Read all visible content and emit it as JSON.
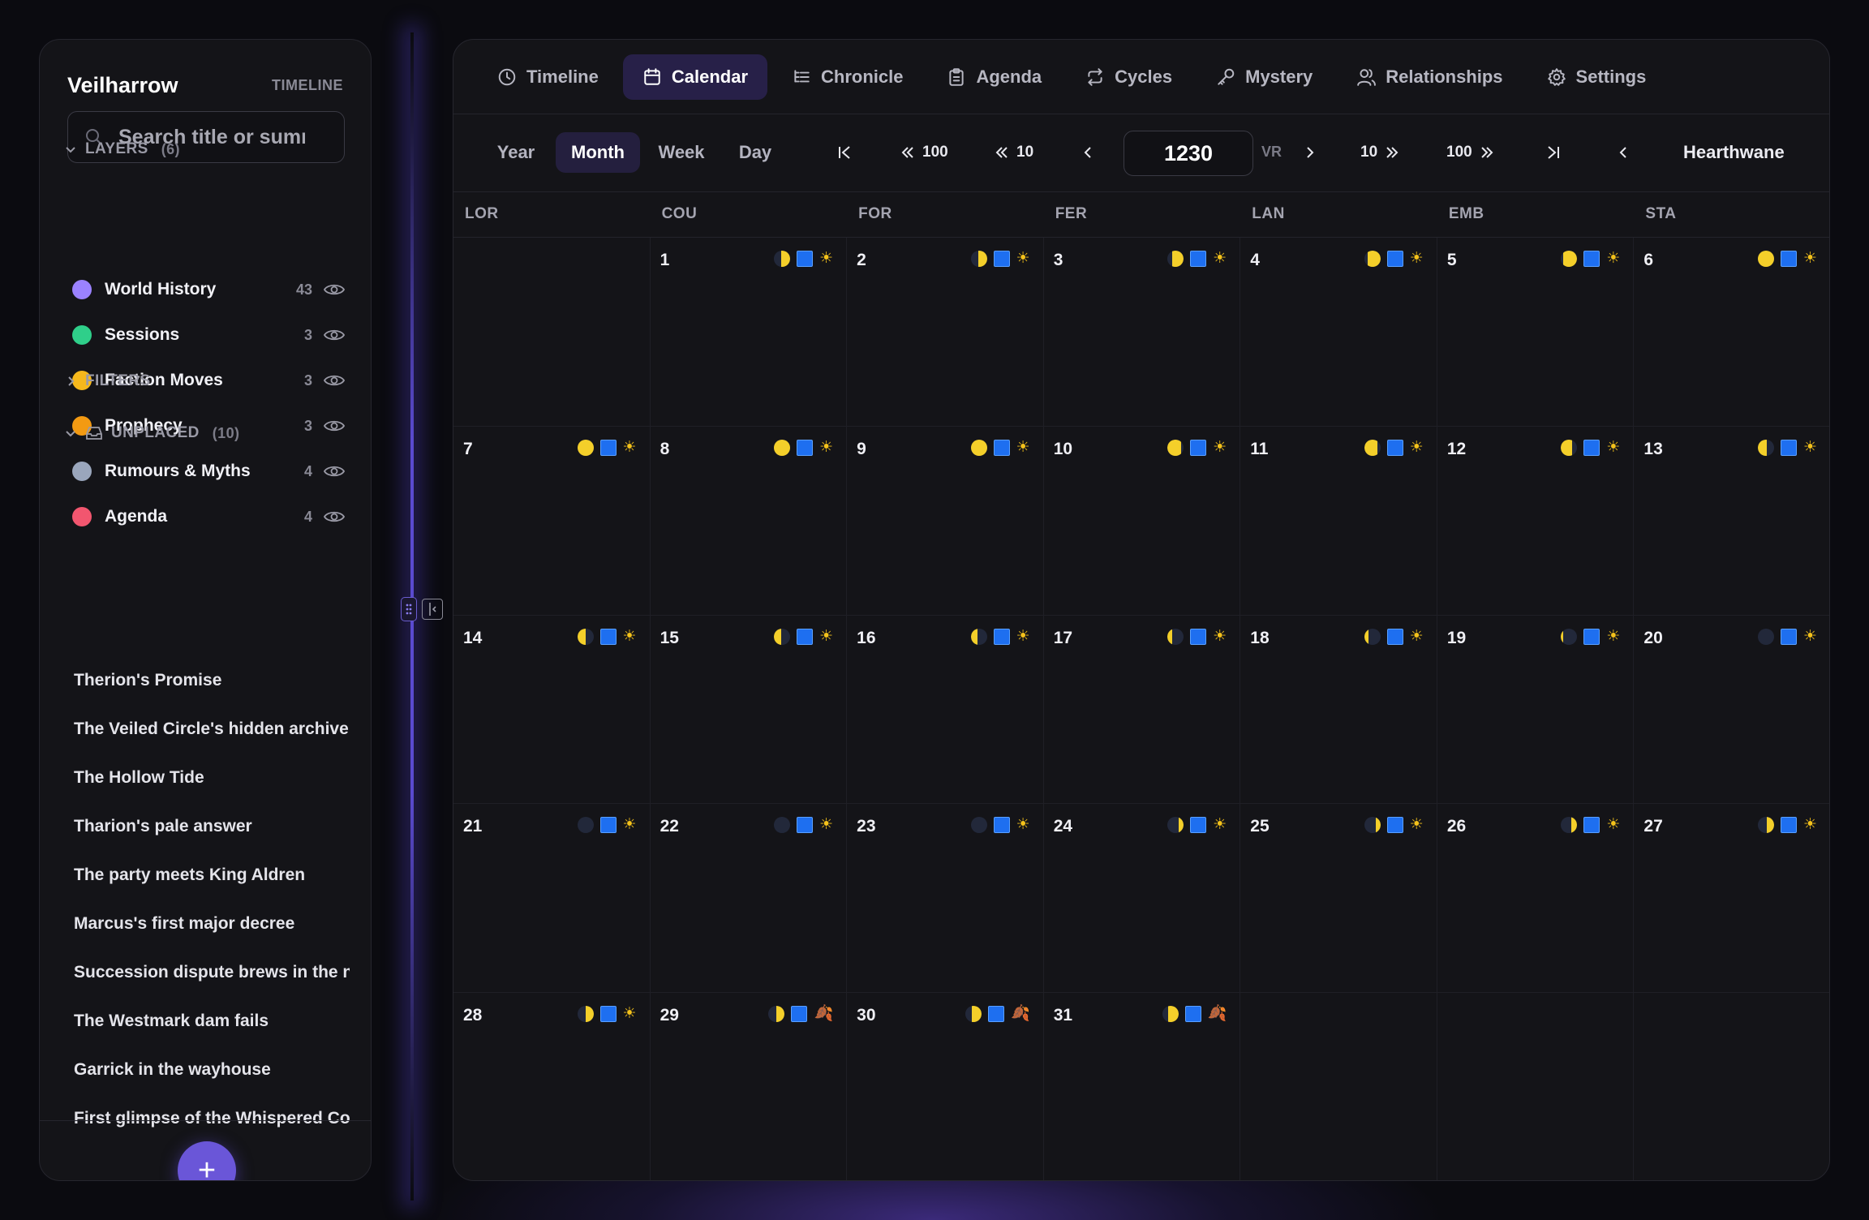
{
  "sidebar": {
    "brand": "Veilharrow",
    "brand_tag": "TIMELINE",
    "search_placeholder": "Search title or summary",
    "layers_label": "LAYERS",
    "layers_count": "(6)",
    "layers": [
      {
        "name": "World History",
        "count": "43",
        "color": "#9b82ff"
      },
      {
        "name": "Sessions",
        "count": "3",
        "color": "#2fcf8a"
      },
      {
        "name": "Faction Moves",
        "count": "3",
        "color": "#f6b81c"
      },
      {
        "name": "Prophecy",
        "count": "3",
        "color": "#f39a12"
      },
      {
        "name": "Rumours & Myths",
        "count": "4",
        "color": "#9aa6bc"
      },
      {
        "name": "Agenda",
        "count": "4",
        "color": "#f2566f"
      }
    ],
    "filters_label": "FILTERS",
    "unplaced_label": "UNPLACED",
    "unplaced_count": "(10)",
    "unplaced": [
      "Therion's Promise",
      "The Veiled Circle's hidden archive",
      "The Hollow Tide",
      "Tharion's pale answer",
      "The party meets King Aldren",
      "Marcus's first major decree",
      "Succession dispute brews in the north",
      "The Westmark dam fails",
      "Garrick in the wayhouse",
      "First glimpse of the Whispered Court"
    ],
    "add_label": "+"
  },
  "tabs": [
    {
      "label": "Timeline",
      "icon": "clock-icon",
      "active": false
    },
    {
      "label": "Calendar",
      "icon": "calendar-icon",
      "active": true
    },
    {
      "label": "Chronicle",
      "icon": "list-tree-icon",
      "active": false
    },
    {
      "label": "Agenda",
      "icon": "clipboard-icon",
      "active": false
    },
    {
      "label": "Cycles",
      "icon": "repeat-icon",
      "active": false
    },
    {
      "label": "Mystery",
      "icon": "key-icon",
      "active": false
    },
    {
      "label": "Relationships",
      "icon": "users-icon",
      "active": false
    },
    {
      "label": "Settings",
      "icon": "gear-icon",
      "active": false
    }
  ],
  "toolbar": {
    "views": [
      "Year",
      "Month",
      "Week",
      "Day"
    ],
    "active_view": "Month",
    "back_100": "100",
    "back_10": "10",
    "fwd_10": "10",
    "fwd_100": "100",
    "year": "1230",
    "era": "VR",
    "month": "Hearthwane"
  },
  "calendar": {
    "weekdays": [
      "LOR",
      "COU",
      "FOR",
      "FER",
      "LAN",
      "EMB",
      "STA"
    ],
    "leading_blanks": 1,
    "days": [
      {
        "d": "1",
        "moon": 0.55,
        "moon_side": "right",
        "weather": "sun"
      },
      {
        "d": "2",
        "moon": 0.55,
        "moon_side": "right",
        "weather": "sun"
      },
      {
        "d": "3",
        "moon": 0.7,
        "moon_side": "right",
        "weather": "sun"
      },
      {
        "d": "4",
        "moon": 0.8,
        "moon_side": "right",
        "weather": "sun"
      },
      {
        "d": "5",
        "moon": 0.85,
        "moon_side": "right",
        "weather": "sun"
      },
      {
        "d": "6",
        "moon": 1.0,
        "moon_side": "full",
        "weather": "sun"
      },
      {
        "d": "7",
        "moon": 1.0,
        "moon_side": "full",
        "weather": "sun"
      },
      {
        "d": "8",
        "moon": 1.0,
        "moon_side": "full",
        "weather": "sun"
      },
      {
        "d": "9",
        "moon": 1.0,
        "moon_side": "full",
        "weather": "sun"
      },
      {
        "d": "10",
        "moon": 0.85,
        "moon_side": "left",
        "weather": "sun"
      },
      {
        "d": "11",
        "moon": 0.8,
        "moon_side": "left",
        "weather": "sun"
      },
      {
        "d": "12",
        "moon": 0.7,
        "moon_side": "left",
        "weather": "sun"
      },
      {
        "d": "13",
        "moon": 0.55,
        "moon_side": "left",
        "weather": "sun"
      },
      {
        "d": "14",
        "moon": 0.5,
        "moon_side": "left",
        "weather": "sun"
      },
      {
        "d": "15",
        "moon": 0.45,
        "moon_side": "left",
        "weather": "sun"
      },
      {
        "d": "16",
        "moon": 0.4,
        "moon_side": "left",
        "weather": "sun"
      },
      {
        "d": "17",
        "moon": 0.3,
        "moon_side": "left",
        "weather": "sun"
      },
      {
        "d": "18",
        "moon": 0.25,
        "moon_side": "left",
        "weather": "sun"
      },
      {
        "d": "19",
        "moon": 0.15,
        "moon_side": "left",
        "weather": "sun"
      },
      {
        "d": "20",
        "moon": 0.0,
        "moon_side": "new",
        "weather": "sun"
      },
      {
        "d": "21",
        "moon": 0.0,
        "moon_side": "new",
        "weather": "sun"
      },
      {
        "d": "22",
        "moon": 0.0,
        "moon_side": "new",
        "weather": "sun"
      },
      {
        "d": "23",
        "moon": 0.0,
        "moon_side": "new",
        "weather": "sun"
      },
      {
        "d": "24",
        "moon": 0.3,
        "moon_side": "right",
        "weather": "sun"
      },
      {
        "d": "25",
        "moon": 0.3,
        "moon_side": "right",
        "weather": "sun"
      },
      {
        "d": "26",
        "moon": 0.35,
        "moon_side": "right",
        "weather": "sun"
      },
      {
        "d": "27",
        "moon": 0.45,
        "moon_side": "right",
        "weather": "sun"
      },
      {
        "d": "28",
        "moon": 0.5,
        "moon_side": "right",
        "weather": "sun"
      },
      {
        "d": "29",
        "moon": 0.5,
        "moon_side": "right",
        "weather": "leaf"
      },
      {
        "d": "30",
        "moon": 0.6,
        "moon_side": "right",
        "weather": "leaf"
      },
      {
        "d": "31",
        "moon": 0.65,
        "moon_side": "right",
        "weather": "leaf"
      }
    ]
  }
}
